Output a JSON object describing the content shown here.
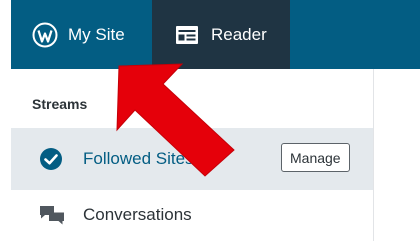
{
  "topbar": {
    "my_site_label": "My Site",
    "reader_label": "Reader"
  },
  "sidebar": {
    "section_title": "Streams",
    "items": [
      {
        "label": "Followed Sites",
        "icon": "checkmark-circle-icon",
        "selected": true,
        "action_label": "Manage"
      },
      {
        "label": "Conversations",
        "icon": "speech-bubbles-icon",
        "selected": false
      }
    ]
  },
  "annotation": {
    "type": "red-arrow-pointer",
    "target": "tab-my-site"
  },
  "colors": {
    "topbar": "#035d83",
    "reader_tab": "#1f3443",
    "selected_row": "#e4e9ed",
    "accent": "#035d83",
    "arrow": "#e5000a"
  }
}
